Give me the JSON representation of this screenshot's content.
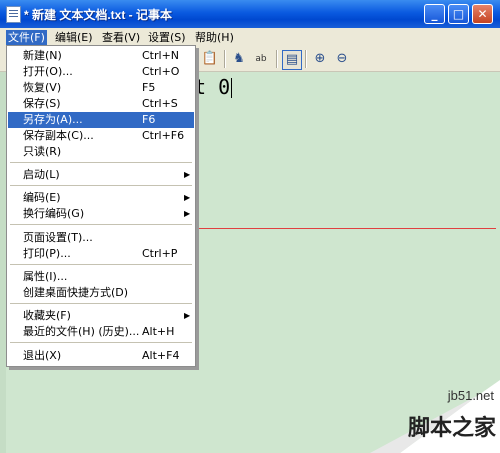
{
  "window": {
    "title": "* 新建 文本文档.txt - 记事本"
  },
  "menubar": [
    {
      "label": "文件(F)",
      "active": true
    },
    {
      "label": "编辑(E)"
    },
    {
      "label": "查看(V)"
    },
    {
      "label": "设置(S)"
    },
    {
      "label": "帮助(H)"
    }
  ],
  "toolbar": {
    "icons": [
      "paste-icon",
      "find-icon",
      "replace-icon",
      "wordwrap-icon",
      "zoom-in-icon",
      "zoom-out-icon"
    ]
  },
  "editor": {
    "text": "t 0"
  },
  "file_menu": [
    {
      "label": "新建(N)",
      "shortcut": "Ctrl+N"
    },
    {
      "label": "打开(O)...",
      "shortcut": "Ctrl+O"
    },
    {
      "label": "恢复(V)",
      "shortcut": "F5"
    },
    {
      "label": "保存(S)",
      "shortcut": "Ctrl+S"
    },
    {
      "label": "另存为(A)...",
      "shortcut": "F6",
      "highlighted": true
    },
    {
      "label": "保存副本(C)...",
      "shortcut": "Ctrl+F6"
    },
    {
      "label": "只读(R)",
      "shortcut": ""
    },
    {
      "label": "启动(L)",
      "shortcut": "",
      "submenu": true
    },
    {
      "label": "编码(E)",
      "shortcut": "",
      "submenu": true
    },
    {
      "label": "换行编码(G)",
      "shortcut": "",
      "submenu": true
    },
    {
      "label": "页面设置(T)...",
      "shortcut": ""
    },
    {
      "label": "打印(P)...",
      "shortcut": "Ctrl+P"
    },
    {
      "label": "属性(I)...",
      "shortcut": ""
    },
    {
      "label": "创建桌面快捷方式(D)",
      "shortcut": ""
    },
    {
      "label": "收藏夹(F)",
      "shortcut": "",
      "submenu": true
    },
    {
      "label": "最近的文件(H) (历史)...",
      "shortcut": "Alt+H"
    },
    {
      "label": "退出(X)",
      "shortcut": "Alt+F4"
    }
  ],
  "watermark": {
    "site": "jb51.net",
    "name": "脚本之家"
  },
  "colors": {
    "highlight": "#316ac5",
    "editor_bg": "#cfe6cf",
    "titlebar": "#0a5ae0"
  }
}
